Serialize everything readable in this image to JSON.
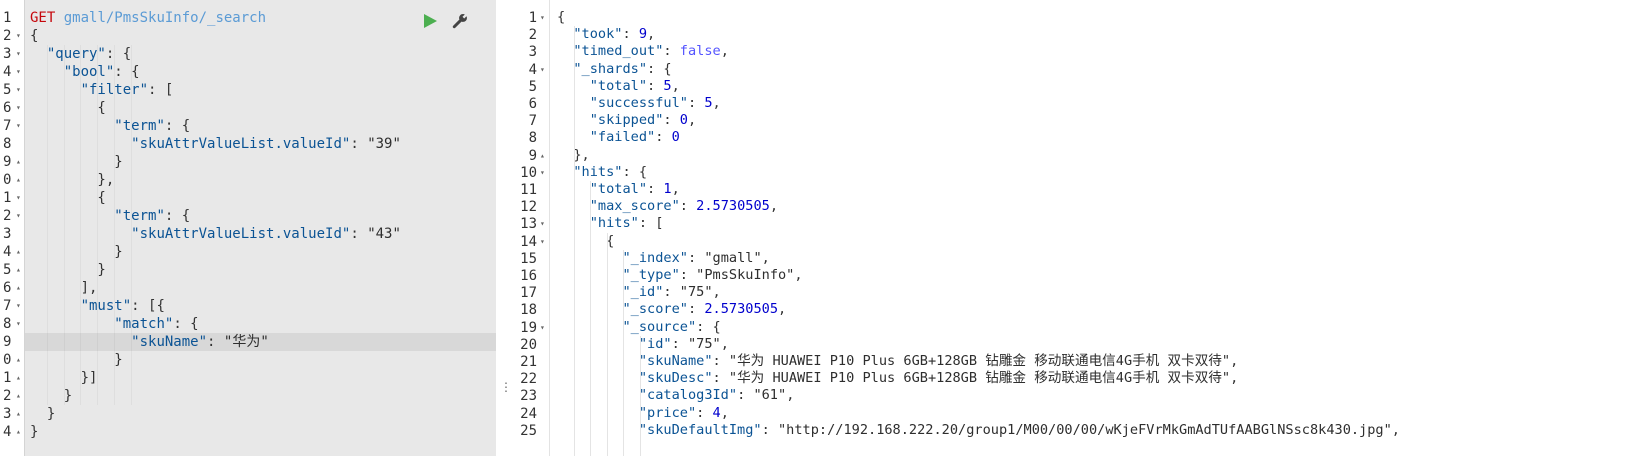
{
  "request": {
    "method": "GET",
    "url": "gmall/PmsSkuInfo/_search",
    "run_icon": "play-icon",
    "settings_icon": "wrench-icon",
    "lines": [
      {
        "num": "1",
        "text": ""
      },
      {
        "num": "2",
        "text": "{"
      },
      {
        "num": "3",
        "text": "  \"query\": {"
      },
      {
        "num": "4",
        "text": "    \"bool\": {"
      },
      {
        "num": "5",
        "text": "      \"filter\": ["
      },
      {
        "num": "6",
        "text": "        {"
      },
      {
        "num": "7",
        "text": "          \"term\": {"
      },
      {
        "num": "8",
        "text": "            \"skuAttrValueList.valueId\": \"39\""
      },
      {
        "num": "9",
        "text": "          }"
      },
      {
        "num": "0",
        "text": "        },"
      },
      {
        "num": "1",
        "text": "        {"
      },
      {
        "num": "2",
        "text": "          \"term\": {"
      },
      {
        "num": "3",
        "text": "            \"skuAttrValueList.valueId\": \"43\""
      },
      {
        "num": "4",
        "text": "          }"
      },
      {
        "num": "5",
        "text": "        }"
      },
      {
        "num": "6",
        "text": "      ],"
      },
      {
        "num": "7",
        "text": "      \"must\": [{"
      },
      {
        "num": "8",
        "text": "          \"match\": {"
      },
      {
        "num": "9",
        "text": "            \"skuName\": \"华为\""
      },
      {
        "num": "0",
        "text": "          }"
      },
      {
        "num": "1",
        "text": "      }]"
      },
      {
        "num": "2",
        "text": "    }"
      },
      {
        "num": "3",
        "text": "  }"
      },
      {
        "num": "4",
        "text": "}"
      }
    ]
  },
  "response": {
    "lines": [
      {
        "num": "1",
        "text": "{"
      },
      {
        "num": "2",
        "text": "  \"took\": 9,"
      },
      {
        "num": "3",
        "text": "  \"timed_out\": false,"
      },
      {
        "num": "4",
        "text": "  \"_shards\": {"
      },
      {
        "num": "5",
        "text": "    \"total\": 5,"
      },
      {
        "num": "6",
        "text": "    \"successful\": 5,"
      },
      {
        "num": "7",
        "text": "    \"skipped\": 0,"
      },
      {
        "num": "8",
        "text": "    \"failed\": 0"
      },
      {
        "num": "9",
        "text": "  },"
      },
      {
        "num": "10",
        "text": "  \"hits\": {"
      },
      {
        "num": "11",
        "text": "    \"total\": 1,"
      },
      {
        "num": "12",
        "text": "    \"max_score\": 2.5730505,"
      },
      {
        "num": "13",
        "text": "    \"hits\": ["
      },
      {
        "num": "14",
        "text": "      {"
      },
      {
        "num": "15",
        "text": "        \"_index\": \"gmall\","
      },
      {
        "num": "16",
        "text": "        \"_type\": \"PmsSkuInfo\","
      },
      {
        "num": "17",
        "text": "        \"_id\": \"75\","
      },
      {
        "num": "18",
        "text": "        \"_score\": 2.5730505,"
      },
      {
        "num": "19",
        "text": "        \"_source\": {"
      },
      {
        "num": "20",
        "text": "          \"id\": \"75\","
      },
      {
        "num": "21",
        "text": "          \"skuName\": \"华为 HUAWEI P10 Plus 6GB+128GB 钻雕金 移动联通电信4G手机 双卡双待\","
      },
      {
        "num": "22",
        "text": "          \"skuDesc\": \"华为 HUAWEI P10 Plus 6GB+128GB 钻雕金 移动联通电信4G手机 双卡双待\","
      },
      {
        "num": "23",
        "text": "          \"catalog3Id\": \"61\","
      },
      {
        "num": "24",
        "text": "          \"price\": 4,"
      },
      {
        "num": "25",
        "text": "          \"skuDefaultImg\": \"http://192.168.222.20/group1/M00/00/00/wKjeFVrMkGmAdTUfAABGlNSsc8k430.jpg\","
      }
    ]
  },
  "colors": {
    "method": "#c5060b",
    "url": "#5b9bd5",
    "key": "#0b5394",
    "run": "#4caf50"
  }
}
